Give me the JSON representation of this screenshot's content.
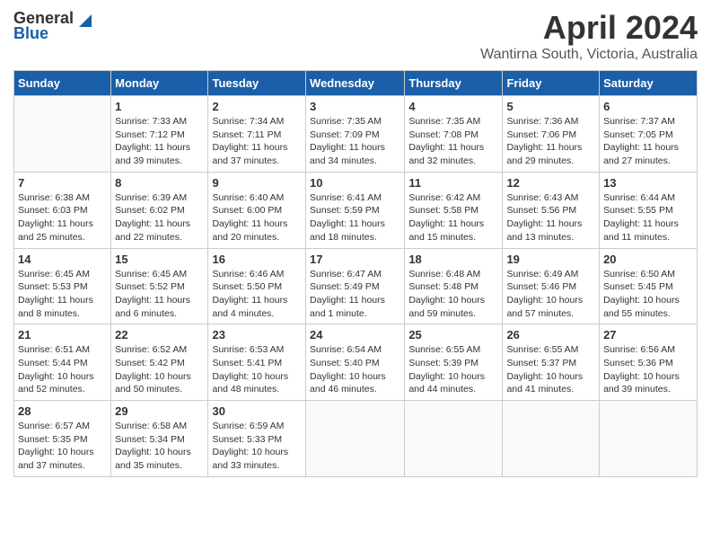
{
  "header": {
    "logo_general": "General",
    "logo_blue": "Blue",
    "title": "April 2024",
    "subtitle": "Wantirna South, Victoria, Australia"
  },
  "calendar": {
    "days_of_week": [
      "Sunday",
      "Monday",
      "Tuesday",
      "Wednesday",
      "Thursday",
      "Friday",
      "Saturday"
    ],
    "weeks": [
      [
        {
          "day": "",
          "info": ""
        },
        {
          "day": "1",
          "info": "Sunrise: 7:33 AM\nSunset: 7:12 PM\nDaylight: 11 hours\nand 39 minutes."
        },
        {
          "day": "2",
          "info": "Sunrise: 7:34 AM\nSunset: 7:11 PM\nDaylight: 11 hours\nand 37 minutes."
        },
        {
          "day": "3",
          "info": "Sunrise: 7:35 AM\nSunset: 7:09 PM\nDaylight: 11 hours\nand 34 minutes."
        },
        {
          "day": "4",
          "info": "Sunrise: 7:35 AM\nSunset: 7:08 PM\nDaylight: 11 hours\nand 32 minutes."
        },
        {
          "day": "5",
          "info": "Sunrise: 7:36 AM\nSunset: 7:06 PM\nDaylight: 11 hours\nand 29 minutes."
        },
        {
          "day": "6",
          "info": "Sunrise: 7:37 AM\nSunset: 7:05 PM\nDaylight: 11 hours\nand 27 minutes."
        }
      ],
      [
        {
          "day": "7",
          "info": "Sunrise: 6:38 AM\nSunset: 6:03 PM\nDaylight: 11 hours\nand 25 minutes."
        },
        {
          "day": "8",
          "info": "Sunrise: 6:39 AM\nSunset: 6:02 PM\nDaylight: 11 hours\nand 22 minutes."
        },
        {
          "day": "9",
          "info": "Sunrise: 6:40 AM\nSunset: 6:00 PM\nDaylight: 11 hours\nand 20 minutes."
        },
        {
          "day": "10",
          "info": "Sunrise: 6:41 AM\nSunset: 5:59 PM\nDaylight: 11 hours\nand 18 minutes."
        },
        {
          "day": "11",
          "info": "Sunrise: 6:42 AM\nSunset: 5:58 PM\nDaylight: 11 hours\nand 15 minutes."
        },
        {
          "day": "12",
          "info": "Sunrise: 6:43 AM\nSunset: 5:56 PM\nDaylight: 11 hours\nand 13 minutes."
        },
        {
          "day": "13",
          "info": "Sunrise: 6:44 AM\nSunset: 5:55 PM\nDaylight: 11 hours\nand 11 minutes."
        }
      ],
      [
        {
          "day": "14",
          "info": "Sunrise: 6:45 AM\nSunset: 5:53 PM\nDaylight: 11 hours\nand 8 minutes."
        },
        {
          "day": "15",
          "info": "Sunrise: 6:45 AM\nSunset: 5:52 PM\nDaylight: 11 hours\nand 6 minutes."
        },
        {
          "day": "16",
          "info": "Sunrise: 6:46 AM\nSunset: 5:50 PM\nDaylight: 11 hours\nand 4 minutes."
        },
        {
          "day": "17",
          "info": "Sunrise: 6:47 AM\nSunset: 5:49 PM\nDaylight: 11 hours\nand 1 minute."
        },
        {
          "day": "18",
          "info": "Sunrise: 6:48 AM\nSunset: 5:48 PM\nDaylight: 10 hours\nand 59 minutes."
        },
        {
          "day": "19",
          "info": "Sunrise: 6:49 AM\nSunset: 5:46 PM\nDaylight: 10 hours\nand 57 minutes."
        },
        {
          "day": "20",
          "info": "Sunrise: 6:50 AM\nSunset: 5:45 PM\nDaylight: 10 hours\nand 55 minutes."
        }
      ],
      [
        {
          "day": "21",
          "info": "Sunrise: 6:51 AM\nSunset: 5:44 PM\nDaylight: 10 hours\nand 52 minutes."
        },
        {
          "day": "22",
          "info": "Sunrise: 6:52 AM\nSunset: 5:42 PM\nDaylight: 10 hours\nand 50 minutes."
        },
        {
          "day": "23",
          "info": "Sunrise: 6:53 AM\nSunset: 5:41 PM\nDaylight: 10 hours\nand 48 minutes."
        },
        {
          "day": "24",
          "info": "Sunrise: 6:54 AM\nSunset: 5:40 PM\nDaylight: 10 hours\nand 46 minutes."
        },
        {
          "day": "25",
          "info": "Sunrise: 6:55 AM\nSunset: 5:39 PM\nDaylight: 10 hours\nand 44 minutes."
        },
        {
          "day": "26",
          "info": "Sunrise: 6:55 AM\nSunset: 5:37 PM\nDaylight: 10 hours\nand 41 minutes."
        },
        {
          "day": "27",
          "info": "Sunrise: 6:56 AM\nSunset: 5:36 PM\nDaylight: 10 hours\nand 39 minutes."
        }
      ],
      [
        {
          "day": "28",
          "info": "Sunrise: 6:57 AM\nSunset: 5:35 PM\nDaylight: 10 hours\nand 37 minutes."
        },
        {
          "day": "29",
          "info": "Sunrise: 6:58 AM\nSunset: 5:34 PM\nDaylight: 10 hours\nand 35 minutes."
        },
        {
          "day": "30",
          "info": "Sunrise: 6:59 AM\nSunset: 5:33 PM\nDaylight: 10 hours\nand 33 minutes."
        },
        {
          "day": "",
          "info": ""
        },
        {
          "day": "",
          "info": ""
        },
        {
          "day": "",
          "info": ""
        },
        {
          "day": "",
          "info": ""
        }
      ]
    ]
  }
}
